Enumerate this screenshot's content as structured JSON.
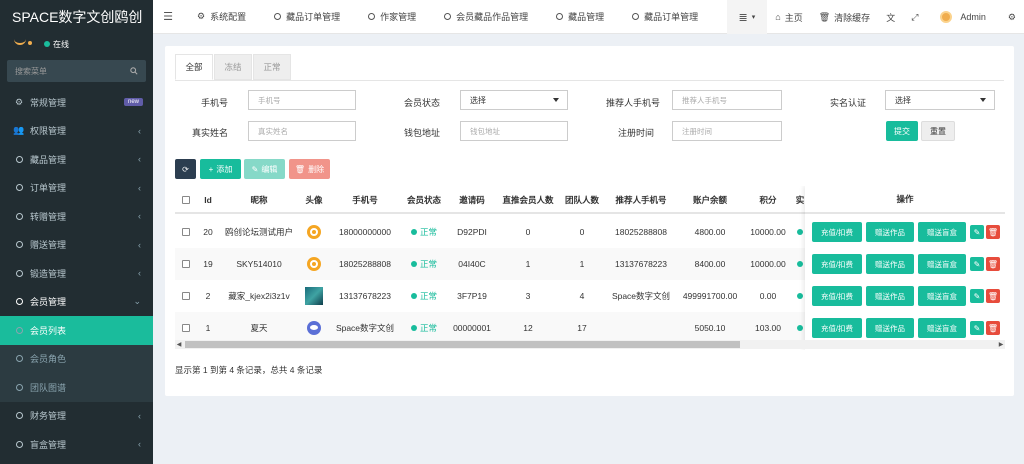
{
  "sidebar": {
    "logo": "SPACE数字文创鸥创",
    "online": "在线",
    "search_placeholder": "搜索菜单",
    "items": [
      {
        "label": "常规管理",
        "badge": "new"
      },
      {
        "label": "权限管理"
      },
      {
        "label": "藏品管理"
      },
      {
        "label": "订单管理"
      },
      {
        "label": "转赠管理"
      },
      {
        "label": "赠送管理"
      },
      {
        "label": "锻造管理"
      },
      {
        "label": "会员管理"
      },
      {
        "label": "会员列表"
      },
      {
        "label": "会员角色"
      },
      {
        "label": "团队图谱"
      },
      {
        "label": "财务管理"
      },
      {
        "label": "盲盒管理"
      }
    ]
  },
  "topbar": {
    "tabs": [
      "系统配置",
      "藏品订单管理",
      "作家管理",
      "会员藏品作品管理",
      "藏品管理",
      "藏品订单管理"
    ],
    "home": "主页",
    "clear_cache": "清除缓存",
    "admin": "Admin"
  },
  "filter_tabs": [
    "全部",
    "冻结",
    "正常"
  ],
  "form": {
    "phone_label": "手机号",
    "phone_placeholder": "手机号",
    "status_label": "会员状态",
    "status_value": "选择",
    "ref_phone_label": "推荐人手机号",
    "ref_phone_placeholder": "推荐人手机号",
    "realname_verify_label": "实名认证",
    "realname_verify_value": "选择",
    "realname_label": "真实姓名",
    "realname_placeholder": "真实姓名",
    "wallet_label": "钱包地址",
    "wallet_placeholder": "钱包地址",
    "regtime_label": "注册时间",
    "regtime_placeholder": "注册时间",
    "submit": "提交",
    "reset": "重置"
  },
  "toolbar": {
    "add": "添加",
    "edit": "编辑",
    "delete": "删除"
  },
  "table": {
    "headers": [
      "Id",
      "昵称",
      "头像",
      "手机号",
      "会员状态",
      "邀请码",
      "直推会员人数",
      "团队人数",
      "推荐人手机号",
      "账户余额",
      "积分",
      "实"
    ],
    "ops_header": "操作",
    "rows": [
      {
        "id": "20",
        "nickname": "鸥创论坛测试用户",
        "phone": "18000000000",
        "status": "正常",
        "code": "D92PDI",
        "direct": "0",
        "team": "0",
        "ref": "18025288808",
        "balance": "4800.00",
        "points": "10000.00"
      },
      {
        "id": "19",
        "nickname": "SKY514010",
        "phone": "18025288808",
        "status": "正常",
        "code": "04I40C",
        "direct": "1",
        "team": "1",
        "ref": "13137678223",
        "balance": "8400.00",
        "points": "10000.00"
      },
      {
        "id": "2",
        "nickname": "藏家_kjex2i3z1v",
        "phone": "13137678223",
        "status": "正常",
        "code": "3F7P19",
        "direct": "3",
        "team": "4",
        "ref": "Space数字文创",
        "balance": "499991700.00",
        "points": "0.00"
      },
      {
        "id": "1",
        "nickname": "夏天",
        "phone": "Space数字文创",
        "status": "正常",
        "code": "00000001",
        "direct": "12",
        "team": "17",
        "ref": "",
        "balance": "5050.10",
        "points": "103.00"
      }
    ],
    "op_buttons": [
      "充值/扣费",
      "赠送作品",
      "赠送盲盒"
    ]
  },
  "summary": "显示第 1 到第 4 条记录，总共 4 条记录"
}
